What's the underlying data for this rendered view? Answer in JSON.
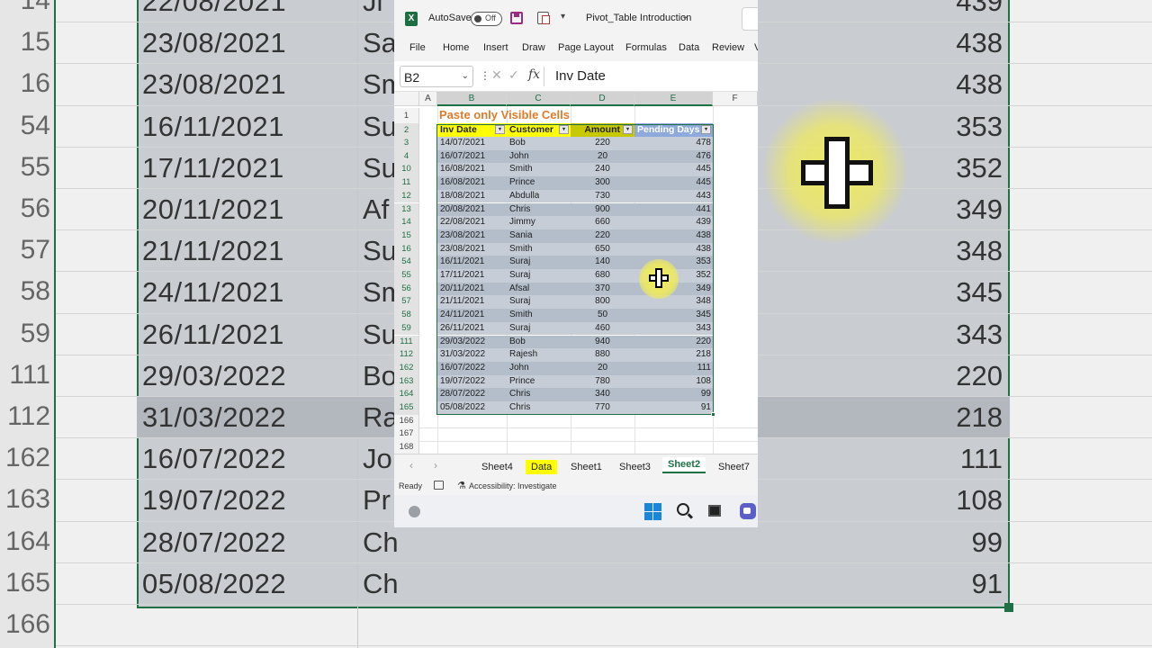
{
  "app": {
    "autosave_label": "AutoSave",
    "autosave_state": "Off",
    "doc_title": "Pivot_Table Introduction"
  },
  "ribbon_tabs": [
    "File",
    "Home",
    "Insert",
    "Draw",
    "Page Layout",
    "Formulas",
    "Data",
    "Review",
    "V"
  ],
  "formula_bar": {
    "name_box": "B2",
    "fx": "fx",
    "value": "Inv Date"
  },
  "columns": [
    "A",
    "B",
    "C",
    "D",
    "E",
    "F"
  ],
  "sheet": {
    "title": "Paste only Visible Cells",
    "title_row": "1",
    "header_row": "2",
    "headers": [
      "Inv Date",
      "Customer",
      "Amount",
      "Pending Days"
    ],
    "rows": [
      {
        "r": "3",
        "date": "14/07/2021",
        "name": "Bob",
        "amount": "220",
        "days": "478"
      },
      {
        "r": "4",
        "date": "16/07/2021",
        "name": "John",
        "amount": "20",
        "days": "476"
      },
      {
        "r": "10",
        "date": "16/08/2021",
        "name": "Smith",
        "amount": "240",
        "days": "445"
      },
      {
        "r": "11",
        "date": "16/08/2021",
        "name": "Prince",
        "amount": "300",
        "days": "445"
      },
      {
        "r": "12",
        "date": "18/08/2021",
        "name": "Abdulla",
        "amount": "730",
        "days": "443"
      },
      {
        "r": "13",
        "date": "20/08/2021",
        "name": "Chris",
        "amount": "900",
        "days": "441"
      },
      {
        "r": "14",
        "date": "22/08/2021",
        "name": "Jimmy",
        "amount": "660",
        "days": "439"
      },
      {
        "r": "15",
        "date": "23/08/2021",
        "name": "Sania",
        "amount": "220",
        "days": "438"
      },
      {
        "r": "16",
        "date": "23/08/2021",
        "name": "Smith",
        "amount": "650",
        "days": "438"
      },
      {
        "r": "54",
        "date": "16/11/2021",
        "name": "Suraj",
        "amount": "140",
        "days": "353"
      },
      {
        "r": "55",
        "date": "17/11/2021",
        "name": "Suraj",
        "amount": "680",
        "days": "352"
      },
      {
        "r": "56",
        "date": "20/11/2021",
        "name": "Afsal",
        "amount": "370",
        "days": "349"
      },
      {
        "r": "57",
        "date": "21/11/2021",
        "name": "Suraj",
        "amount": "800",
        "days": "348"
      },
      {
        "r": "58",
        "date": "24/11/2021",
        "name": "Smith",
        "amount": "50",
        "days": "345"
      },
      {
        "r": "59",
        "date": "26/11/2021",
        "name": "Suraj",
        "amount": "460",
        "days": "343"
      },
      {
        "r": "111",
        "date": "29/03/2022",
        "name": "Bob",
        "amount": "940",
        "days": "220"
      },
      {
        "r": "112",
        "date": "31/03/2022",
        "name": "Rajesh",
        "amount": "880",
        "days": "218"
      },
      {
        "r": "162",
        "date": "16/07/2022",
        "name": "John",
        "amount": "20",
        "days": "111"
      },
      {
        "r": "163",
        "date": "19/07/2022",
        "name": "Prince",
        "amount": "780",
        "days": "108"
      },
      {
        "r": "164",
        "date": "28/07/2022",
        "name": "Chris",
        "amount": "340",
        "days": "99"
      },
      {
        "r": "165",
        "date": "05/08/2022",
        "name": "Chris",
        "amount": "770",
        "days": "91"
      }
    ],
    "empty_rows": [
      "166",
      "167",
      "168"
    ]
  },
  "sheet_tabs": [
    {
      "label": "Sheet4",
      "style": "normal"
    },
    {
      "label": "Data",
      "style": "yellow"
    },
    {
      "label": "Sheet1",
      "style": "normal"
    },
    {
      "label": "Sheet3",
      "style": "normal"
    },
    {
      "label": "Sheet2",
      "style": "active"
    },
    {
      "label": "Sheet7",
      "style": "normal"
    }
  ],
  "status": {
    "ready": "Ready",
    "accessibility": "Accessibility: Investigate"
  },
  "background_zoom": {
    "rows": [
      {
        "r": "14",
        "date": "22/08/2021",
        "name": "Ji",
        "days": "439"
      },
      {
        "r": "15",
        "date": "23/08/2021",
        "name": "Sa",
        "days": "438"
      },
      {
        "r": "16",
        "date": "23/08/2021",
        "name": "Sm",
        "days": "438"
      },
      {
        "r": "54",
        "date": "16/11/2021",
        "name": "Su",
        "days": "353"
      },
      {
        "r": "55",
        "date": "17/11/2021",
        "name": "Su",
        "days": "352"
      },
      {
        "r": "56",
        "date": "20/11/2021",
        "name": "Af",
        "days": "349"
      },
      {
        "r": "57",
        "date": "21/11/2021",
        "name": "Su",
        "days": "348"
      },
      {
        "r": "58",
        "date": "24/11/2021",
        "name": "Sm",
        "days": "345"
      },
      {
        "r": "59",
        "date": "26/11/2021",
        "name": "Su",
        "days": "343"
      },
      {
        "r": "111",
        "date": "29/03/2022",
        "name": "Bo",
        "days": "220"
      },
      {
        "r": "112",
        "date": "31/03/2022",
        "name": "Ra",
        "days": "218"
      },
      {
        "r": "162",
        "date": "16/07/2022",
        "name": "Jo",
        "days": "111"
      },
      {
        "r": "163",
        "date": "19/07/2022",
        "name": "Pr",
        "days": "108"
      },
      {
        "r": "164",
        "date": "28/07/2022",
        "name": "Ch",
        "days": "99"
      },
      {
        "r": "165",
        "date": "05/08/2022",
        "name": "Ch",
        "days": "91"
      },
      {
        "r": "166",
        "date": "",
        "name": "",
        "days": ""
      }
    ]
  },
  "colors": {
    "accent": "#1e7145",
    "title_orange": "#e07b2a",
    "header_yellow": "#ffff00",
    "header_olive": "#c8c800",
    "header_blue": "#8ea9db",
    "selection": "#c6cdd6",
    "selection_dark": "#b4becb"
  }
}
